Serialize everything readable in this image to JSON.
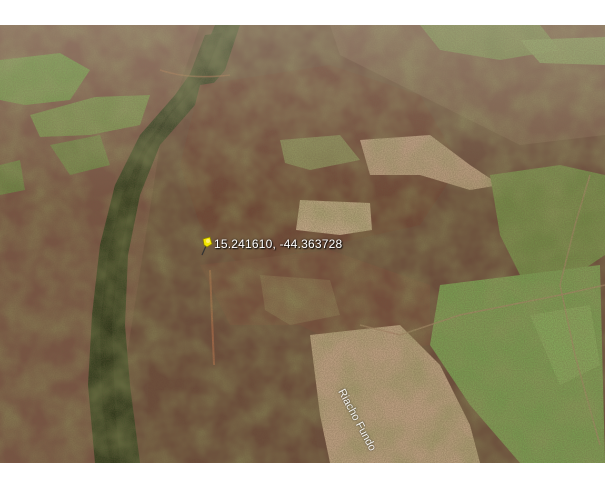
{
  "map": {
    "view": "satellite",
    "placemark": {
      "label": "15.241610, -44.363728",
      "icon": "yellow-pushpin-icon",
      "color": "#f2e600"
    },
    "road_label": "Riacho Fundo",
    "colors": {
      "frame": "#ffffff",
      "forest": "#3f4a22",
      "river_forest": "#2d3a1a",
      "pasture_green": "#6f9a45",
      "bare_soil": "#c9a98a",
      "scrub_brown": "#7a5040"
    }
  }
}
